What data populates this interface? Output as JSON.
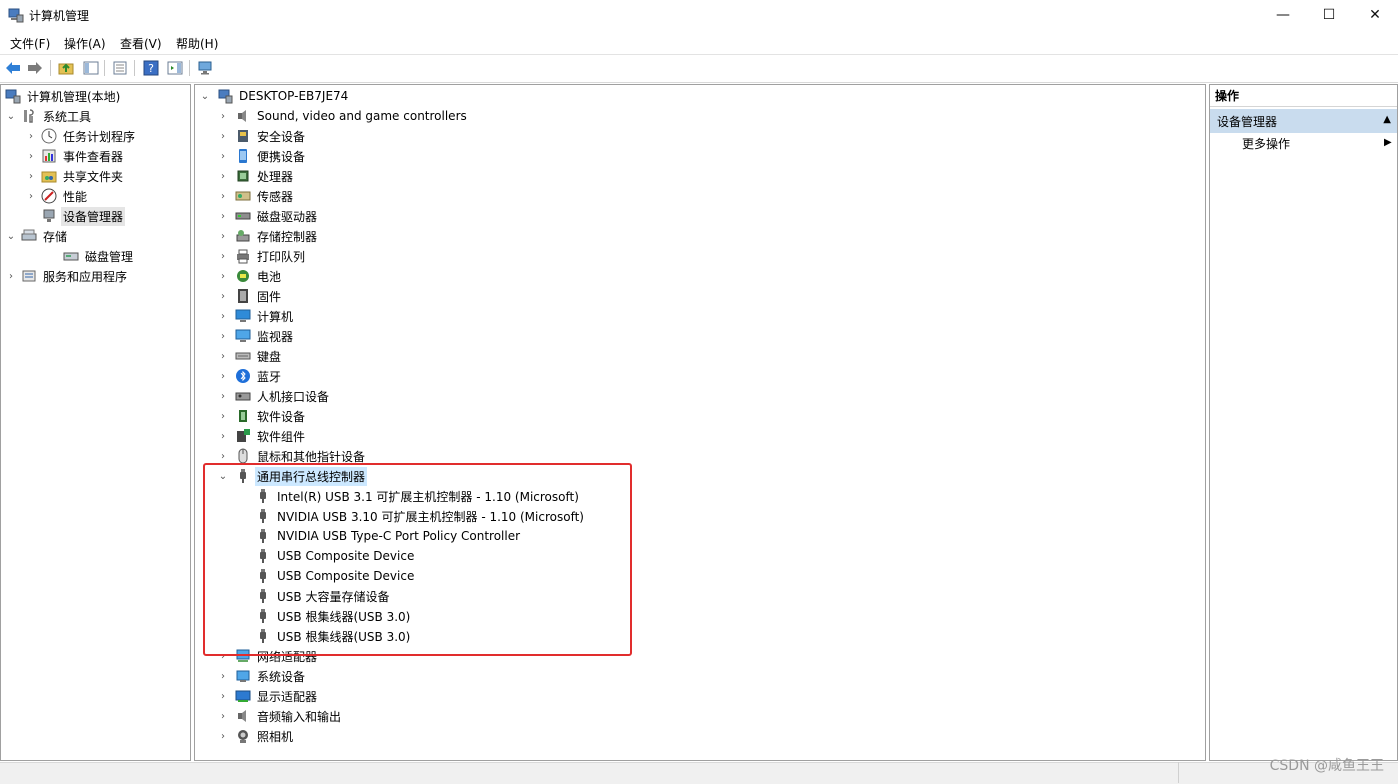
{
  "window": {
    "title": "计算机管理",
    "buttons": {
      "minimize": "—",
      "maximize": "☐",
      "close": "✕"
    }
  },
  "menu": [
    "文件(F)",
    "操作(A)",
    "查看(V)",
    "帮助(H)"
  ],
  "left_tree": {
    "root": "计算机管理(本地)",
    "system_tools": "系统工具",
    "task_scheduler": "任务计划程序",
    "event_viewer": "事件查看器",
    "shared_folders": "共享文件夹",
    "performance": "性能",
    "device_manager": "设备管理器",
    "storage": "存储",
    "disk_management": "磁盘管理",
    "services": "服务和应用程序"
  },
  "device_tree": {
    "computer": "DESKTOP-EB7JE74",
    "categories": [
      {
        "label": "Sound, video and game controllers",
        "icon": "speaker-icon"
      },
      {
        "label": "安全设备",
        "icon": "security-icon"
      },
      {
        "label": "便携设备",
        "icon": "portable-icon"
      },
      {
        "label": "处理器",
        "icon": "cpu-icon"
      },
      {
        "label": "传感器",
        "icon": "sensor-icon"
      },
      {
        "label": "磁盘驱动器",
        "icon": "disk-icon"
      },
      {
        "label": "存储控制器",
        "icon": "storage-controller-icon"
      },
      {
        "label": "打印队列",
        "icon": "printer-icon"
      },
      {
        "label": "电池",
        "icon": "battery-icon"
      },
      {
        "label": "固件",
        "icon": "firmware-icon"
      },
      {
        "label": "计算机",
        "icon": "computer-icon"
      },
      {
        "label": "监视器",
        "icon": "monitor-icon"
      },
      {
        "label": "键盘",
        "icon": "keyboard-icon"
      },
      {
        "label": "蓝牙",
        "icon": "bluetooth-icon"
      },
      {
        "label": "人机接口设备",
        "icon": "hid-icon"
      },
      {
        "label": "软件设备",
        "icon": "software-device-icon"
      },
      {
        "label": "软件组件",
        "icon": "software-component-icon"
      },
      {
        "label": "鼠标和其他指针设备",
        "icon": "mouse-icon"
      }
    ],
    "usb_category": "通用串行总线控制器",
    "usb_children": [
      "Intel(R) USB 3.1 可扩展主机控制器 - 1.10 (Microsoft)",
      "NVIDIA USB 3.10 可扩展主机控制器 - 1.10 (Microsoft)",
      "NVIDIA USB Type-C Port Policy Controller",
      "USB Composite Device",
      "USB Composite Device",
      "USB 大容量存储设备",
      "USB 根集线器(USB 3.0)",
      "USB 根集线器(USB 3.0)"
    ],
    "after_categories": [
      {
        "label": "网络适配器",
        "icon": "network-adapter-icon"
      },
      {
        "label": "系统设备",
        "icon": "system-device-icon"
      },
      {
        "label": "显示适配器",
        "icon": "display-adapter-icon"
      },
      {
        "label": "音频输入和输出",
        "icon": "audio-io-icon"
      },
      {
        "label": "照相机",
        "icon": "camera-icon"
      }
    ]
  },
  "actions_pane": {
    "header": "操作",
    "section": "设备管理器",
    "more": "更多操作"
  },
  "watermark": "CSDN @咸鱼王王",
  "colors": {
    "highlight": "#e12d2d",
    "selection": "#cce8ff",
    "section_bg": "#c9dcee"
  }
}
